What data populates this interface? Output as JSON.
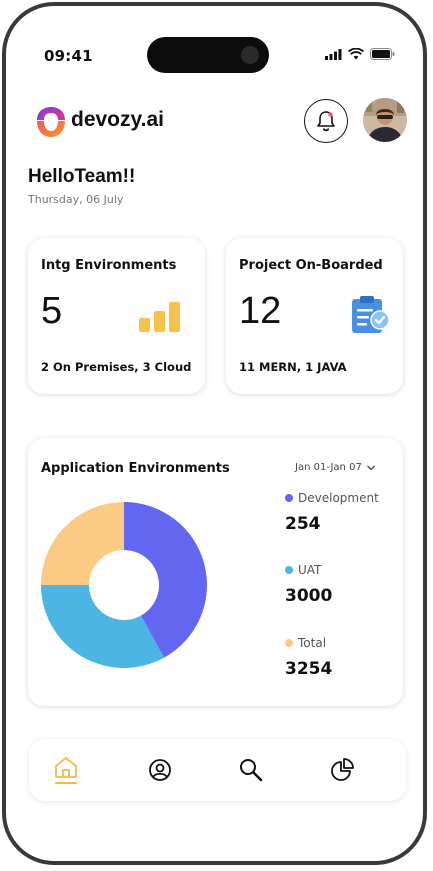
{
  "status_bar": {
    "time": "09:41"
  },
  "brand": {
    "name": "devozy.ai"
  },
  "greeting": {
    "title": "HelloTeam!!",
    "date": "Thursday, 06 July"
  },
  "cards": [
    {
      "title": "Intg Environments",
      "value": "5",
      "subtitle": "2 On Premises, 3 Cloud",
      "icon": "bar-chart-icon",
      "accent": "#F8C14A"
    },
    {
      "title": "Project On-Boarded",
      "value": "12",
      "subtitle": "11 MERN, 1 JAVA",
      "icon": "clipboard-check-icon",
      "accent": "#4A90E2"
    }
  ],
  "app_env": {
    "title": "Application Environments",
    "range": "Jan 01-Jan 07",
    "legend": [
      {
        "label": "Development",
        "value": "254",
        "color": "#6366F1"
      },
      {
        "label": "UAT",
        "value": "3000",
        "color": "#4DB5E3"
      },
      {
        "label": "Total",
        "value": "3254",
        "color": "#FBCB86"
      }
    ]
  },
  "chart_data": {
    "type": "pie",
    "title": "Application Environments",
    "categories": [
      "Development",
      "UAT",
      "Total"
    ],
    "values": [
      42,
      33,
      25
    ],
    "colors": [
      "#6366F1",
      "#4DB5E3",
      "#FBCB86"
    ],
    "donut": true
  },
  "nav": [
    {
      "icon": "home-icon",
      "active": true
    },
    {
      "icon": "profile-icon",
      "active": false
    },
    {
      "icon": "search-icon",
      "active": false
    },
    {
      "icon": "pie-chart-icon",
      "active": false
    }
  ]
}
